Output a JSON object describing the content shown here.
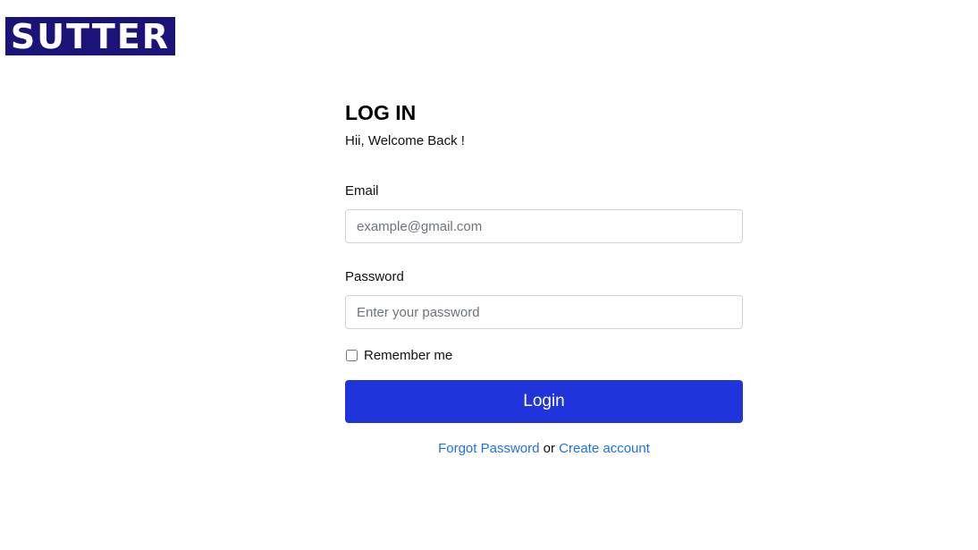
{
  "brand": {
    "logo_text": "SUTTER",
    "color": "#1b1478"
  },
  "login": {
    "title": "LOG IN",
    "subtitle": "Hii, Welcome Back !",
    "email": {
      "label": "Email",
      "placeholder": "example@gmail.com",
      "value": ""
    },
    "password": {
      "label": "Password",
      "placeholder": "Enter your password",
      "value": ""
    },
    "remember": {
      "label": "Remember me",
      "checked": false
    },
    "submit_label": "Login",
    "forgot_label": "Forgot Password",
    "separator": "or",
    "create_label": "Create account"
  },
  "colors": {
    "accent": "#1f35db",
    "link": "#1a73e8"
  }
}
